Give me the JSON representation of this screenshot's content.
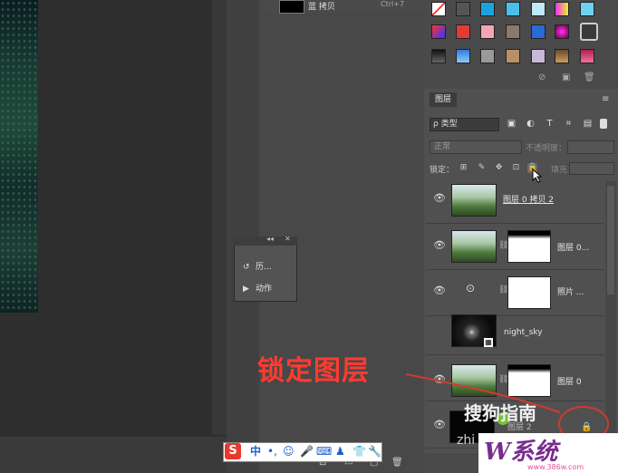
{
  "history": {
    "snapshot_label": "蓝 拷贝",
    "shortcut": "Ctrl+7"
  },
  "float_panel": {
    "header_collapse": "◂◂",
    "header_close": "✕",
    "items": [
      {
        "icon": "history-icon",
        "label": "历..."
      },
      {
        "icon": "play-action-icon",
        "label": "动作"
      }
    ]
  },
  "layers_panel": {
    "tab_label": "图层",
    "menu_glyph": "≡",
    "filter_label": "ρ 类型",
    "blend_mode": "正常",
    "opacity_label": "不透明度：",
    "lock_label": "锁定：",
    "fill_label": "填充：",
    "layers": [
      {
        "name": "图层 0 拷贝 2",
        "has_mask": false,
        "thumb": "landscape"
      },
      {
        "name": "图层 0...",
        "has_mask": true,
        "thumb": "landscape"
      },
      {
        "name": "照片 ...",
        "has_mask": true,
        "thumb": "adjustment"
      },
      {
        "name": "night_sky",
        "has_mask": false,
        "thumb": "sky"
      },
      {
        "name": "图层 0",
        "has_mask": true,
        "thumb": "landscape"
      },
      {
        "name": "图层 2",
        "has_mask": false,
        "thumb": "dark"
      }
    ]
  },
  "annotation": {
    "text": "锁定图层"
  },
  "watermarks": {
    "sogou": "搜狗指南",
    "zhi": "zhi",
    "logo_text": "W系统",
    "logo_url": "www.386w.com"
  },
  "ime_toolbar": {
    "logo": "S",
    "mode": "中",
    "punct": "•,"
  },
  "colors": {
    "annotation": "#ff3b30",
    "panel_bg": "#505050",
    "canvas_bg": "#2e2e2e",
    "logo_purple": "#7a2c8e"
  }
}
